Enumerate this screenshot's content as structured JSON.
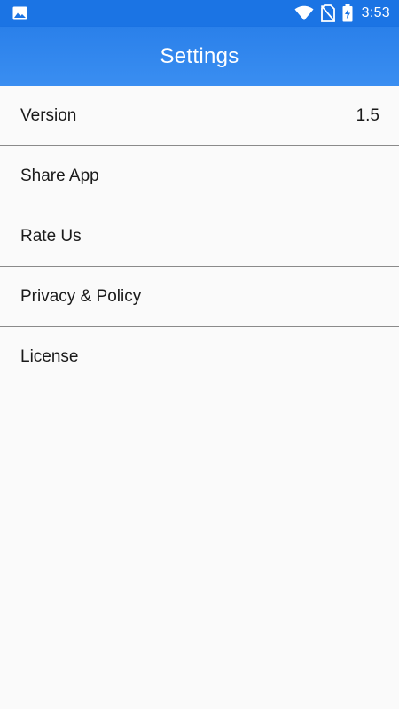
{
  "status_bar": {
    "time": "3:53",
    "icons": [
      "image-notification-icon",
      "wifi-icon",
      "no-sim-icon",
      "battery-charging-icon"
    ]
  },
  "app_bar": {
    "title": "Settings"
  },
  "settings": {
    "items": [
      {
        "label": "Version",
        "value": "1.5"
      },
      {
        "label": "Share App"
      },
      {
        "label": "Rate Us"
      },
      {
        "label": "Privacy & Policy"
      },
      {
        "label": "License"
      }
    ]
  },
  "colors": {
    "status_bar": "#1b74e4",
    "app_bar": "#3a8ef1",
    "background": "#fafafa",
    "divider": "#8a8a8a"
  }
}
